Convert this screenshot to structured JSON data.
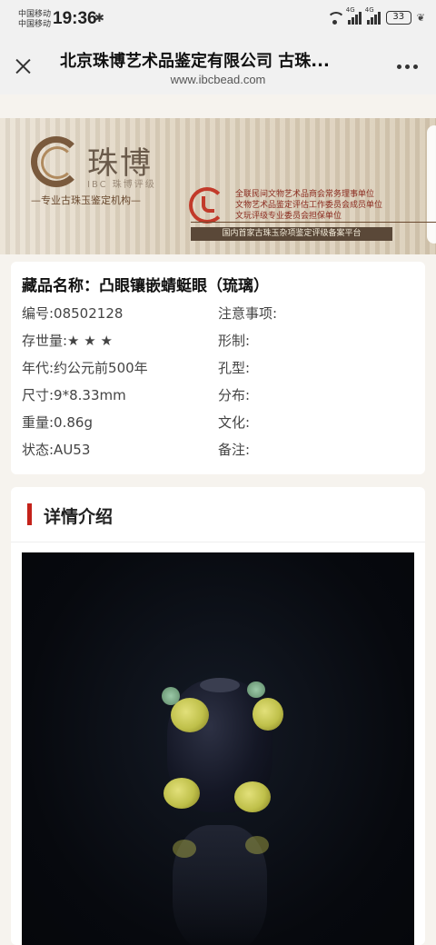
{
  "status_bar": {
    "carrier_1": "中国移动",
    "carrier_2": "中国移动",
    "time": "19:36",
    "network_1": "4G",
    "network_2": "4G",
    "battery": "33"
  },
  "nav": {
    "title": "北京珠博艺术品鉴定有限公司 古珠...",
    "url": "www.ibcbead.com"
  },
  "banner": {
    "brand": "珠博",
    "brand_sub": "IBC 珠博评级",
    "tagline": "—专业古珠玉鉴定机构—",
    "org_line_1": "全联民间文物艺术品商会常务理事单位",
    "org_line_2": "文物艺术品鉴定评估工作委员会成员单位",
    "org_line_3": "文玩评级专业委员会担保单位",
    "strip": "国内首家古珠玉杂项鉴定评级备案平台"
  },
  "item": {
    "title": "藏品名称：凸眼镶嵌蜻蜓眼（琉璃）",
    "rows": [
      {
        "left": "编号:08502128",
        "right": "注意事项:"
      },
      {
        "left": "存世量:★ ★ ★",
        "right": "形制:"
      },
      {
        "left": "年代:约公元前500年",
        "right": "孔型:"
      },
      {
        "left": "尺寸:9*8.33mm",
        "right": "分布:"
      },
      {
        "left": "重量:0.86g",
        "right": "文化:"
      },
      {
        "left": "状态:AU53",
        "right": "备注:"
      }
    ]
  },
  "details": {
    "title": "详情介绍"
  },
  "colors": {
    "accent_red": "#c4221a",
    "page_bg": "#f6f3ee"
  }
}
